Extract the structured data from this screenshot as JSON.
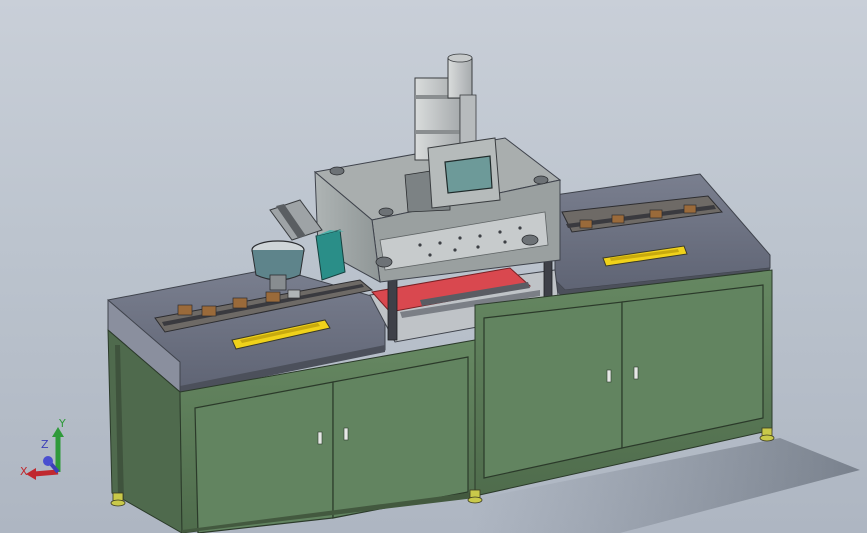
{
  "viewport": {
    "background_top": "#c9cfd8",
    "background_bottom": "#aeb6c2"
  },
  "model": {
    "cabinet_color": "#5f7f5c",
    "tabletop_color": "#6f7484",
    "frame_color": "#5a5c63",
    "accent_red": "#d9484f",
    "label_yellow": "#f0d21a",
    "control_panel_color": "#6d9a99",
    "bowl_color": "#5e848b"
  },
  "triad": {
    "x_label": "X",
    "y_label": "Y",
    "z_label": "Z",
    "x_color": "#c0282e",
    "y_color": "#2f9a3a",
    "z_color": "#3d3fb8"
  }
}
